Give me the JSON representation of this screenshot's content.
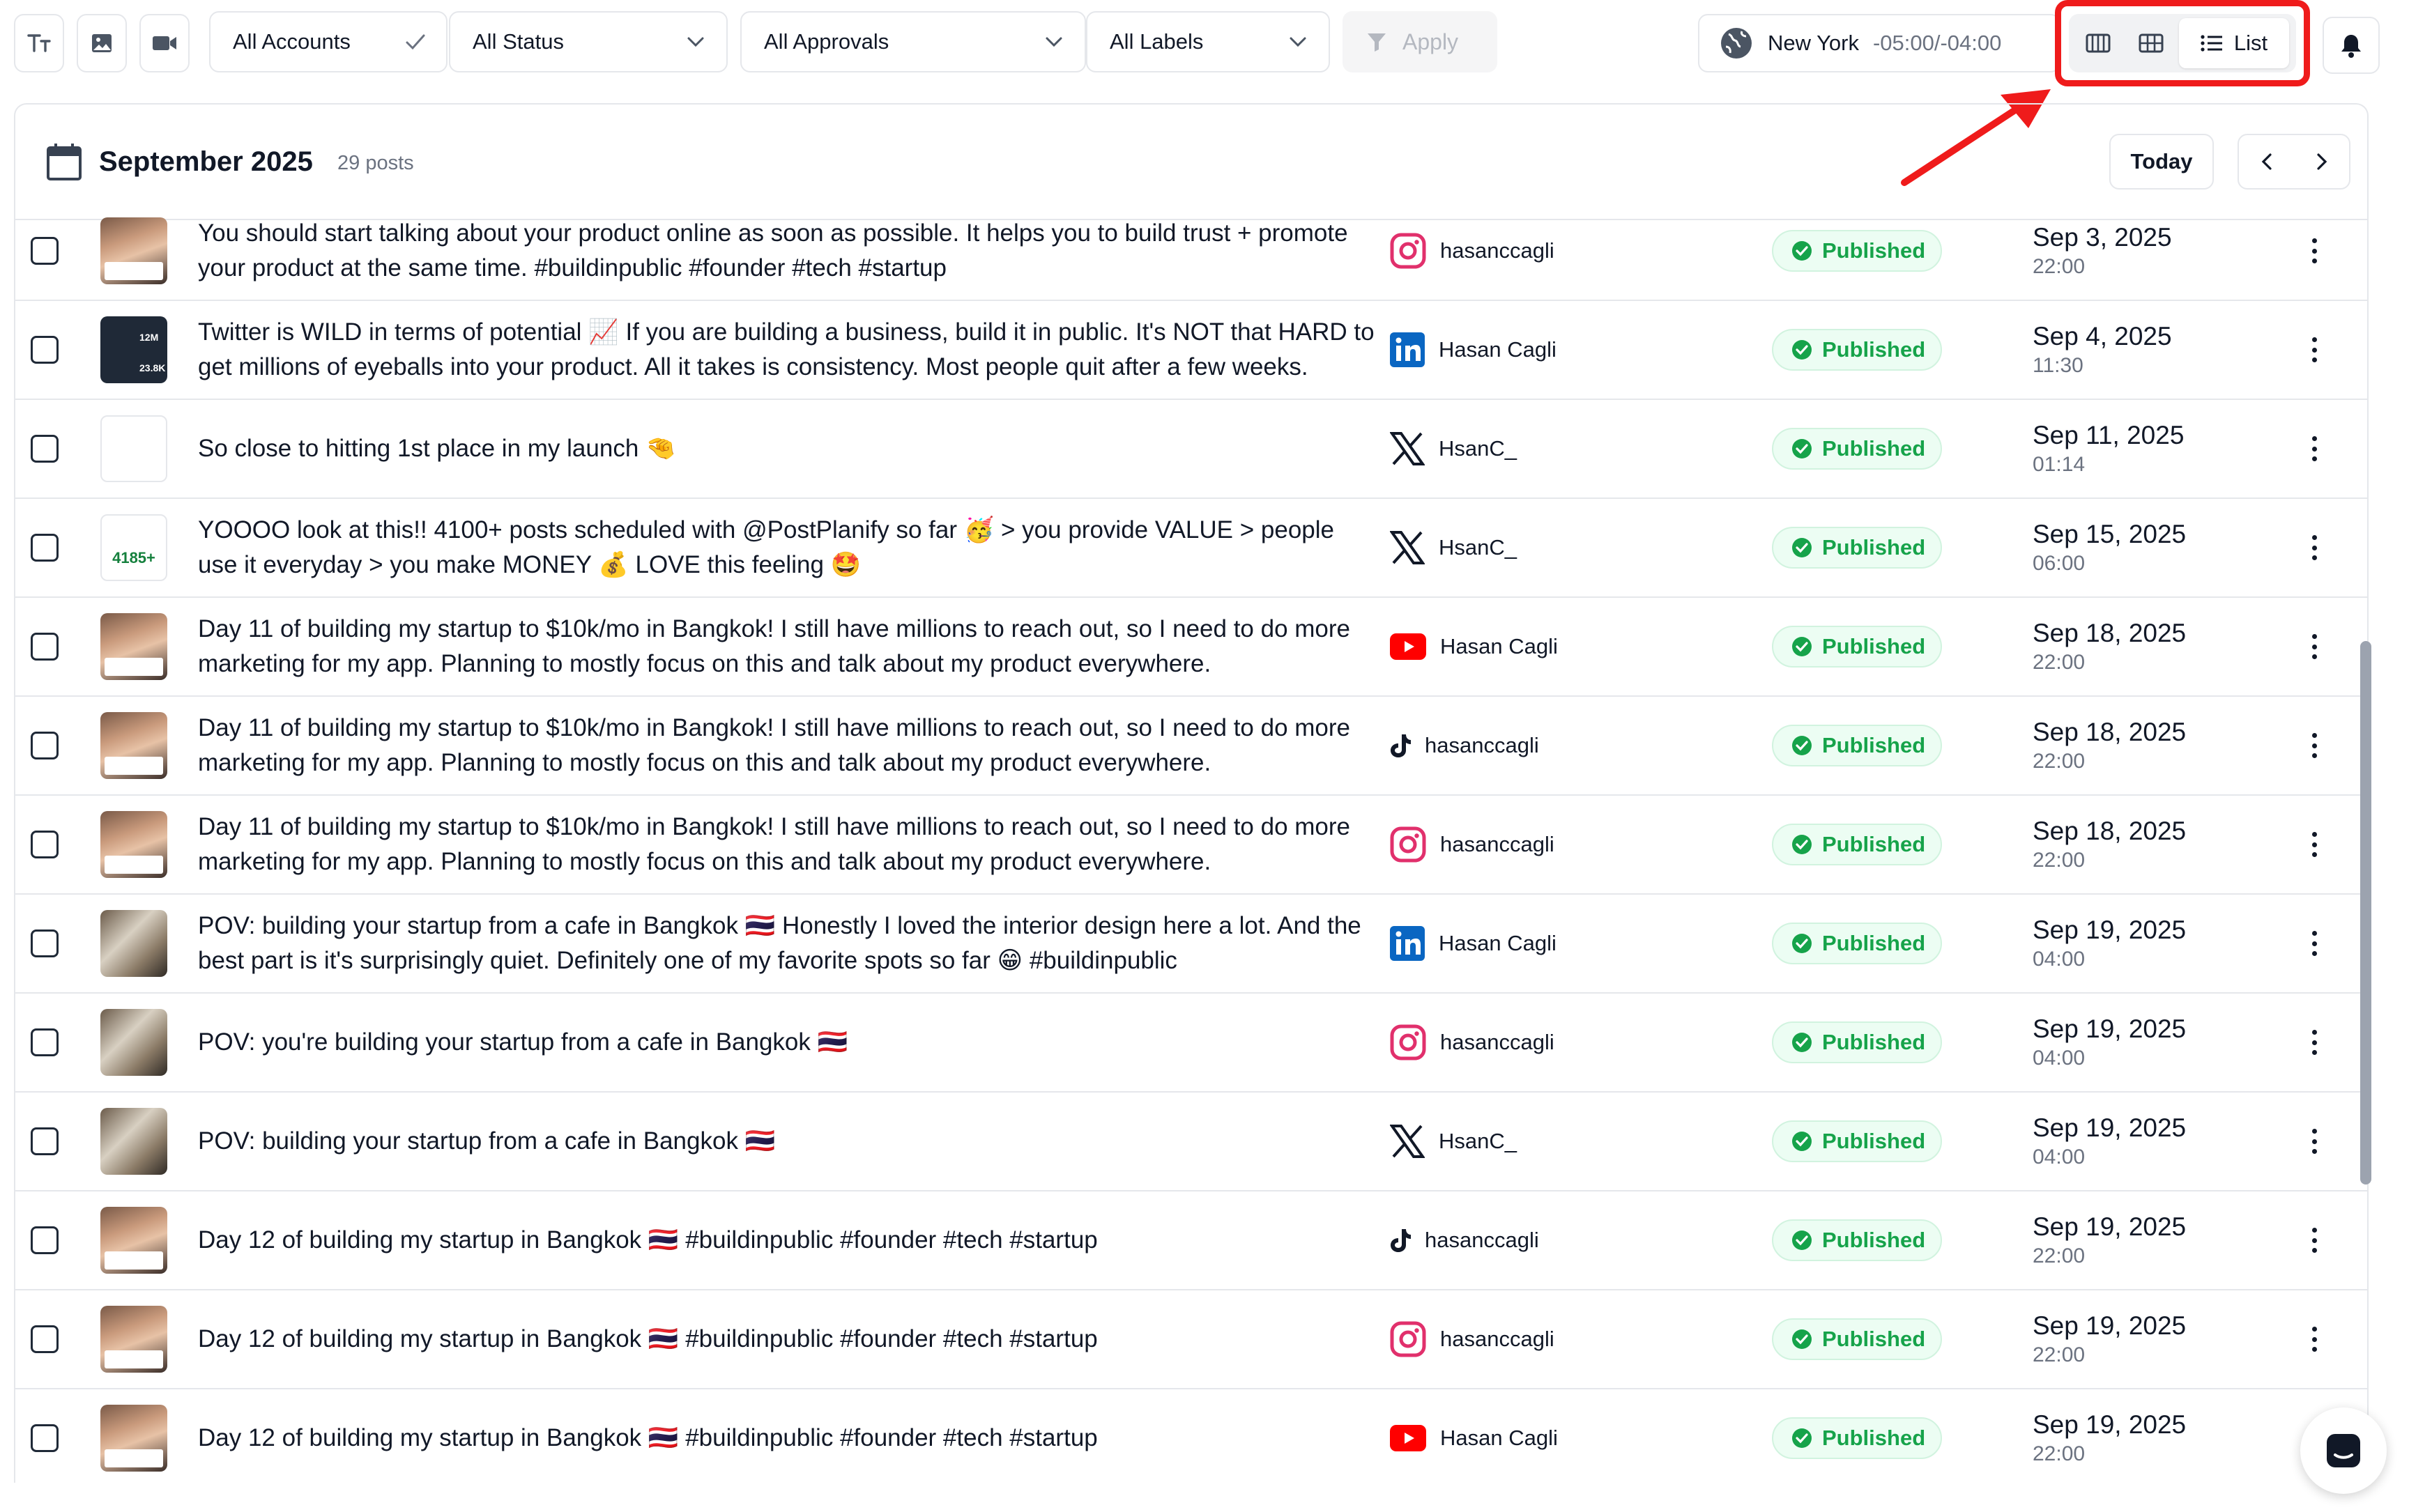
{
  "toolbar": {
    "filters": {
      "accounts": "All Accounts",
      "status": "All Status",
      "approvals": "All Approvals",
      "labels": "All Labels"
    },
    "apply_label": "Apply",
    "timezone": {
      "city": "New York",
      "offset": "-05:00/-04:00"
    },
    "view": {
      "active_label": "List",
      "options": [
        "week-view",
        "month-view",
        "list-view"
      ]
    }
  },
  "calendar": {
    "month": "September 2025",
    "post_count": "29 posts",
    "today_label": "Today"
  },
  "status_label": "Published",
  "colors": {
    "published": "#16a34a",
    "instagram": "#e1306c",
    "linkedin": "#0a66c2",
    "youtube": "#ff0000",
    "highlight": "#ef1b1b"
  },
  "posts": [
    {
      "text": "You should start talking about your product online as soon as possible. It helps you to build trust + promote your product at the same time. #buildinpublic #founder #tech #startup",
      "platform": "instagram",
      "account": "hasanccagli",
      "date": "Sep 3, 2025",
      "time": "22:00",
      "thumb": "face"
    },
    {
      "text": "Twitter is WILD in terms of potential 📈 If you are building a business, build it in public. It's NOT that HARD to get millions of eyeballs into your product. All it takes is consistency. Most people quit after a few weeks.",
      "platform": "linkedin",
      "account": "Hasan Cagli",
      "date": "Sep 4, 2025",
      "time": "11:30",
      "thumb": "dash"
    },
    {
      "text": "So close to hitting 1st place in my launch 🤏",
      "platform": "x",
      "account": "HsanC_",
      "date": "Sep 11, 2025",
      "time": "01:14",
      "thumb": "white"
    },
    {
      "text": "YOOOO look at this!! 4100+ posts scheduled with @PostPlanify so far 🥳 > you provide VALUE > people use it everyday > you make MONEY 💰 LOVE this feeling 🤩",
      "platform": "x",
      "account": "HsanC_",
      "date": "Sep 15, 2025",
      "time": "06:00",
      "thumb": "count"
    },
    {
      "text": "Day 11 of building my startup to $10k/mo in Bangkok! I still have millions to reach out, so I need to do more marketing for my app. Planning to mostly focus on this and talk about my product everywhere.",
      "platform": "youtube",
      "account": "Hasan Cagli",
      "date": "Sep 18, 2025",
      "time": "22:00",
      "thumb": "face"
    },
    {
      "text": "Day 11 of building my startup to $10k/mo in Bangkok! I still have millions to reach out, so I need to do more marketing for my app. Planning to mostly focus on this and talk about my product everywhere.",
      "platform": "tiktok",
      "account": "hasanccagli",
      "date": "Sep 18, 2025",
      "time": "22:00",
      "thumb": "face"
    },
    {
      "text": "Day 11 of building my startup to $10k/mo in Bangkok! I still have millions to reach out, so I need to do more marketing for my app. Planning to mostly focus on this and talk about my product everywhere.",
      "platform": "instagram",
      "account": "hasanccagli",
      "date": "Sep 18, 2025",
      "time": "22:00",
      "thumb": "face"
    },
    {
      "text": "POV: building your startup from a cafe in Bangkok 🇹🇭 Honestly I loved the interior design here a lot. And the best part is it's surprisingly quiet. Definitely one of my favorite spots so far 😁 #buildinpublic",
      "platform": "linkedin",
      "account": "Hasan Cagli",
      "date": "Sep 19, 2025",
      "time": "04:00",
      "thumb": "cafe"
    },
    {
      "text": "POV: you're building your startup from a cafe in Bangkok 🇹🇭",
      "platform": "instagram",
      "account": "hasanccagli",
      "date": "Sep 19, 2025",
      "time": "04:00",
      "thumb": "cafe"
    },
    {
      "text": "POV: building your startup from a cafe in Bangkok 🇹🇭",
      "platform": "x",
      "account": "HsanC_",
      "date": "Sep 19, 2025",
      "time": "04:00",
      "thumb": "cafe"
    },
    {
      "text": "Day 12 of building my startup in Bangkok 🇹🇭 #buildinpublic #founder #tech #startup",
      "platform": "tiktok",
      "account": "hasanccagli",
      "date": "Sep 19, 2025",
      "time": "22:00",
      "thumb": "face"
    },
    {
      "text": "Day 12 of building my startup in Bangkok 🇹🇭 #buildinpublic #founder #tech #startup",
      "platform": "instagram",
      "account": "hasanccagli",
      "date": "Sep 19, 2025",
      "time": "22:00",
      "thumb": "face"
    },
    {
      "text": "Day 12 of building my startup in Bangkok 🇹🇭 #buildinpublic #founder #tech #startup",
      "platform": "youtube",
      "account": "Hasan Cagli",
      "date": "Sep 19, 2025",
      "time": "22:00",
      "thumb": "face"
    }
  ],
  "thumb_labels": {
    "metric": "12M",
    "metric2": "23.8K",
    "count": "4185+"
  }
}
